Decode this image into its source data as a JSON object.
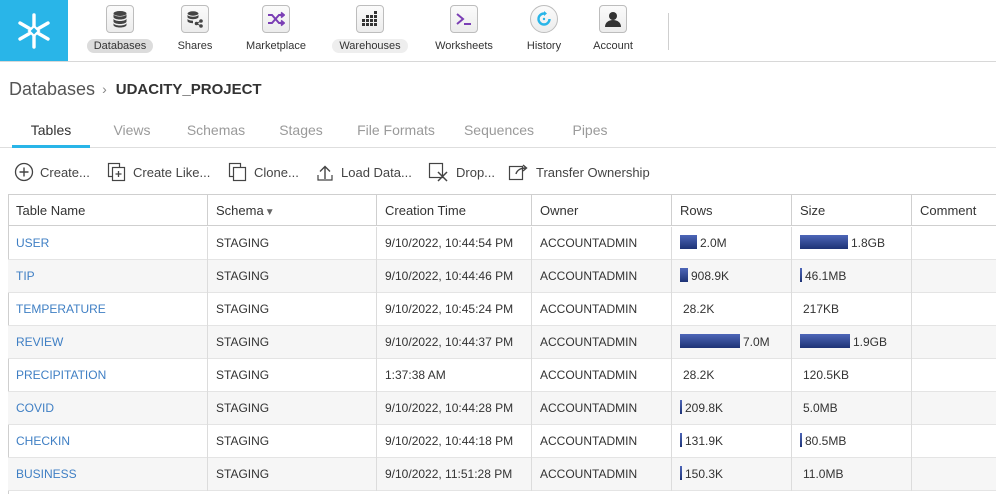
{
  "nav": {
    "items": [
      {
        "label": "Databases",
        "icon": "database-icon",
        "active": true
      },
      {
        "label": "Shares",
        "icon": "share-icon"
      },
      {
        "label": "Marketplace",
        "icon": "marketplace-icon"
      },
      {
        "label": "Warehouses",
        "icon": "warehouse-icon"
      },
      {
        "label": "Worksheets",
        "icon": "terminal-icon"
      },
      {
        "label": "History",
        "icon": "history-icon"
      },
      {
        "label": "Account",
        "icon": "account-icon"
      }
    ]
  },
  "breadcrumb": {
    "root": "Databases",
    "current": "UDACITY_PROJECT"
  },
  "tabs": [
    "Tables",
    "Views",
    "Schemas",
    "Stages",
    "File Formats",
    "Sequences",
    "Pipes"
  ],
  "toolbar": [
    "Create...",
    "Create Like...",
    "Clone...",
    "Load Data...",
    "Drop...",
    "Transfer Ownership"
  ],
  "table": {
    "columns": [
      "Table Name",
      "Schema",
      "Creation Time",
      "Owner",
      "Rows",
      "Size",
      "Comment"
    ],
    "sort_indicator": "▼",
    "rows": [
      {
        "name": "USER",
        "schema": "STAGING",
        "created": "9/10/2022, 10:44:54 PM",
        "owner": "ACCOUNTADMIN",
        "rows": "2.0M",
        "size": "1.8GB",
        "rows_level": 0.28,
        "size_level": 0.96,
        "comment": ""
      },
      {
        "name": "TIP",
        "schema": "STAGING",
        "created": "9/10/2022, 10:44:46 PM",
        "owner": "ACCOUNTADMIN",
        "rows": "908.9K",
        "size": "46.1MB",
        "rows_level": 0.13,
        "size_level": 0.02,
        "comment": ""
      },
      {
        "name": "TEMPERATURE",
        "schema": "STAGING",
        "created": "9/10/2022, 10:45:24 PM",
        "owner": "ACCOUNTADMIN",
        "rows": "28.2K",
        "size": "217KB",
        "rows_level": 0,
        "size_level": 0,
        "comment": ""
      },
      {
        "name": "REVIEW",
        "schema": "STAGING",
        "created": "9/10/2022, 10:44:37 PM",
        "owner": "ACCOUNTADMIN",
        "rows": "7.0M",
        "size": "1.9GB",
        "rows_level": 1.0,
        "size_level": 1.0,
        "comment": ""
      },
      {
        "name": "PRECIPITATION",
        "schema": "STAGING",
        "created": "1:37:38 AM",
        "owner": "ACCOUNTADMIN",
        "rows": "28.2K",
        "size": "120.5KB",
        "rows_level": 0,
        "size_level": 0,
        "comment": ""
      },
      {
        "name": "COVID",
        "schema": "STAGING",
        "created": "9/10/2022, 10:44:28 PM",
        "owner": "ACCOUNTADMIN",
        "rows": "209.8K",
        "size": "5.0MB",
        "rows_level": 0.03,
        "size_level": 0,
        "comment": ""
      },
      {
        "name": "CHECKIN",
        "schema": "STAGING",
        "created": "9/10/2022, 10:44:18 PM",
        "owner": "ACCOUNTADMIN",
        "rows": "131.9K",
        "size": "80.5MB",
        "rows_level": 0.02,
        "size_level": 0.04,
        "comment": ""
      },
      {
        "name": "BUSINESS",
        "schema": "STAGING",
        "created": "9/10/2022, 11:51:28 PM",
        "owner": "ACCOUNTADMIN",
        "rows": "150.3K",
        "size": "11.0MB",
        "rows_level": 0.02,
        "size_level": 0,
        "comment": ""
      }
    ]
  },
  "colors": {
    "brand": "#29b5e8",
    "link": "#3f7fc4",
    "bar": "#2a3f8f"
  }
}
